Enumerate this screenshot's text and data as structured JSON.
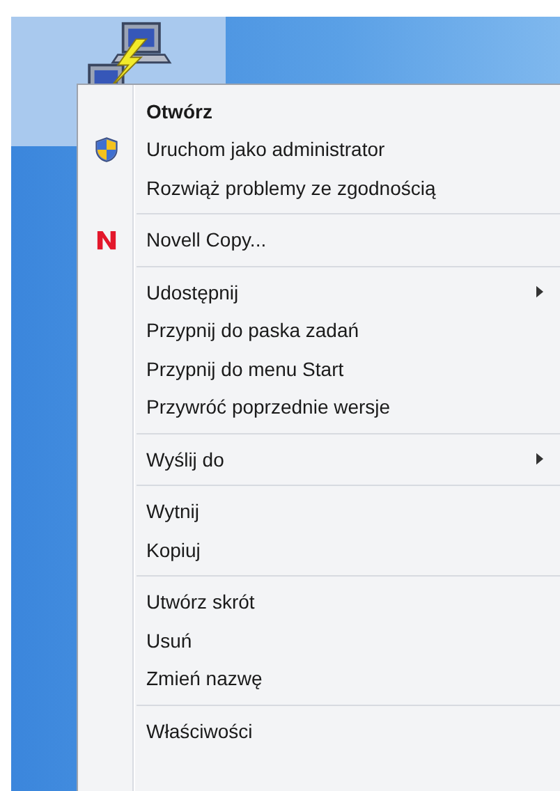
{
  "desktop": {
    "icon": {
      "selected": true
    }
  },
  "context_menu": {
    "groups": [
      [
        {
          "label": "Otwórz",
          "kind": "default"
        },
        {
          "label": "Uruchom jako administrator",
          "kind": "admin"
        },
        {
          "label": "Rozwiąż problemy ze zgodnością",
          "kind": "normal"
        }
      ],
      [
        {
          "label": "Novell Copy...",
          "kind": "app"
        }
      ],
      [
        {
          "label": "Udostępnij",
          "kind": "submenu"
        },
        {
          "label": "Przypnij do paska zadań",
          "kind": "normal"
        },
        {
          "label": "Przypnij do menu Start",
          "kind": "normal"
        },
        {
          "label": "Przywróć poprzednie wersje",
          "kind": "normal"
        }
      ],
      [
        {
          "label": "Wyślij do",
          "kind": "submenu"
        }
      ],
      [
        {
          "label": "Wytnij",
          "kind": "normal"
        },
        {
          "label": "Kopiuj",
          "kind": "normal"
        }
      ],
      [
        {
          "label": "Utwórz skrót",
          "kind": "normal"
        },
        {
          "label": "Usuń",
          "kind": "normal"
        },
        {
          "label": "Zmień nazwę",
          "kind": "normal"
        }
      ],
      [
        {
          "label": "Właściwości",
          "kind": "normal"
        }
      ]
    ]
  }
}
